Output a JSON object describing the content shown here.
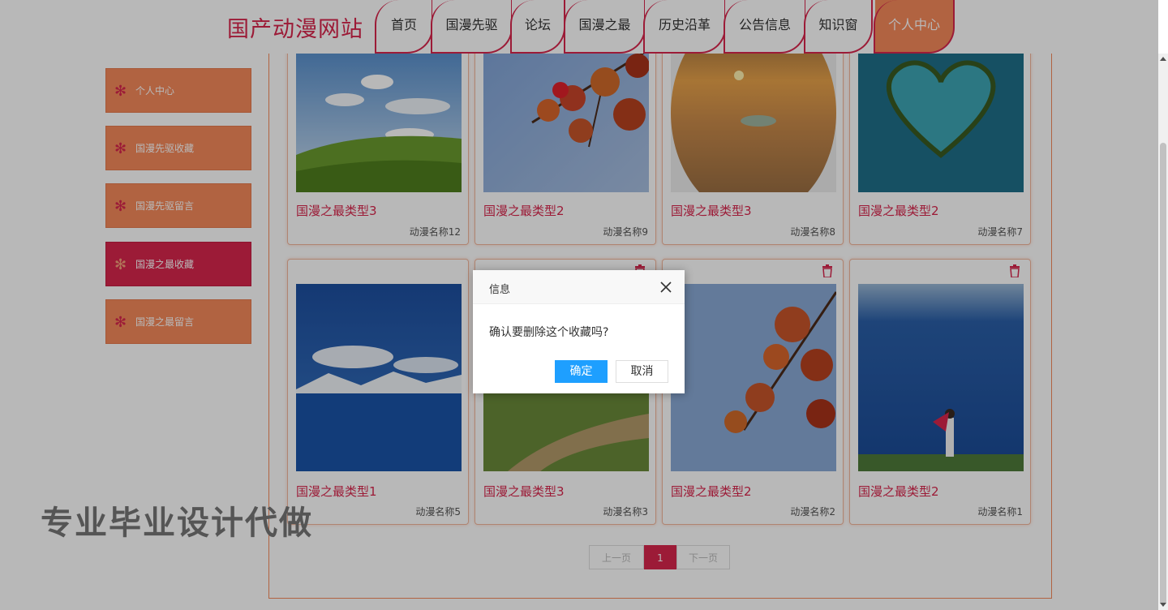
{
  "site": {
    "logo": "国产动漫网站"
  },
  "nav": {
    "items": [
      {
        "label": "首页"
      },
      {
        "label": "国漫先驱"
      },
      {
        "label": "论坛"
      },
      {
        "label": "国漫之最"
      },
      {
        "label": "历史沿革"
      },
      {
        "label": "公告信息"
      },
      {
        "label": "知识窗"
      },
      {
        "label": "个人中心",
        "active": true
      }
    ]
  },
  "sidebar": {
    "items": [
      {
        "label": "个人中心"
      },
      {
        "label": "国漫先驱收藏"
      },
      {
        "label": "国漫先驱留言"
      },
      {
        "label": "国漫之最收藏",
        "active": true
      },
      {
        "label": "国漫之最留言"
      }
    ]
  },
  "cards": [
    {
      "title": "国漫之最类型3",
      "name": "动漫名称12",
      "image": "grassland-sky"
    },
    {
      "title": "国漫之最类型2",
      "name": "动漫名称9",
      "image": "maple-leaves"
    },
    {
      "title": "国漫之最类型3",
      "name": "动漫名称8",
      "image": "desert-sunset"
    },
    {
      "title": "国漫之最类型2",
      "name": "动漫名称7",
      "image": "heart-island"
    },
    {
      "title": "国漫之最类型1",
      "name": "动漫名称5",
      "image": "lake-mountains"
    },
    {
      "title": "国漫之最类型3",
      "name": "动漫名称3",
      "image": "dirt-road-field"
    },
    {
      "title": "国漫之最类型2",
      "name": "动漫名称2",
      "image": "maple-leaves"
    },
    {
      "title": "国漫之最类型2",
      "name": "动漫名称1",
      "image": "lake-umbrella-girl"
    }
  ],
  "pager": {
    "prev": "上一页",
    "current": "1",
    "next": "下一页"
  },
  "dialog": {
    "title": "信息",
    "message": "确认要删除这个收藏吗?",
    "ok": "确定",
    "cancel": "取消"
  },
  "watermark": "专业毕业设计代做",
  "colors": {
    "primary": "#d8264d",
    "accent": "#f6895b",
    "dialog_ok": "#1e9fff"
  }
}
